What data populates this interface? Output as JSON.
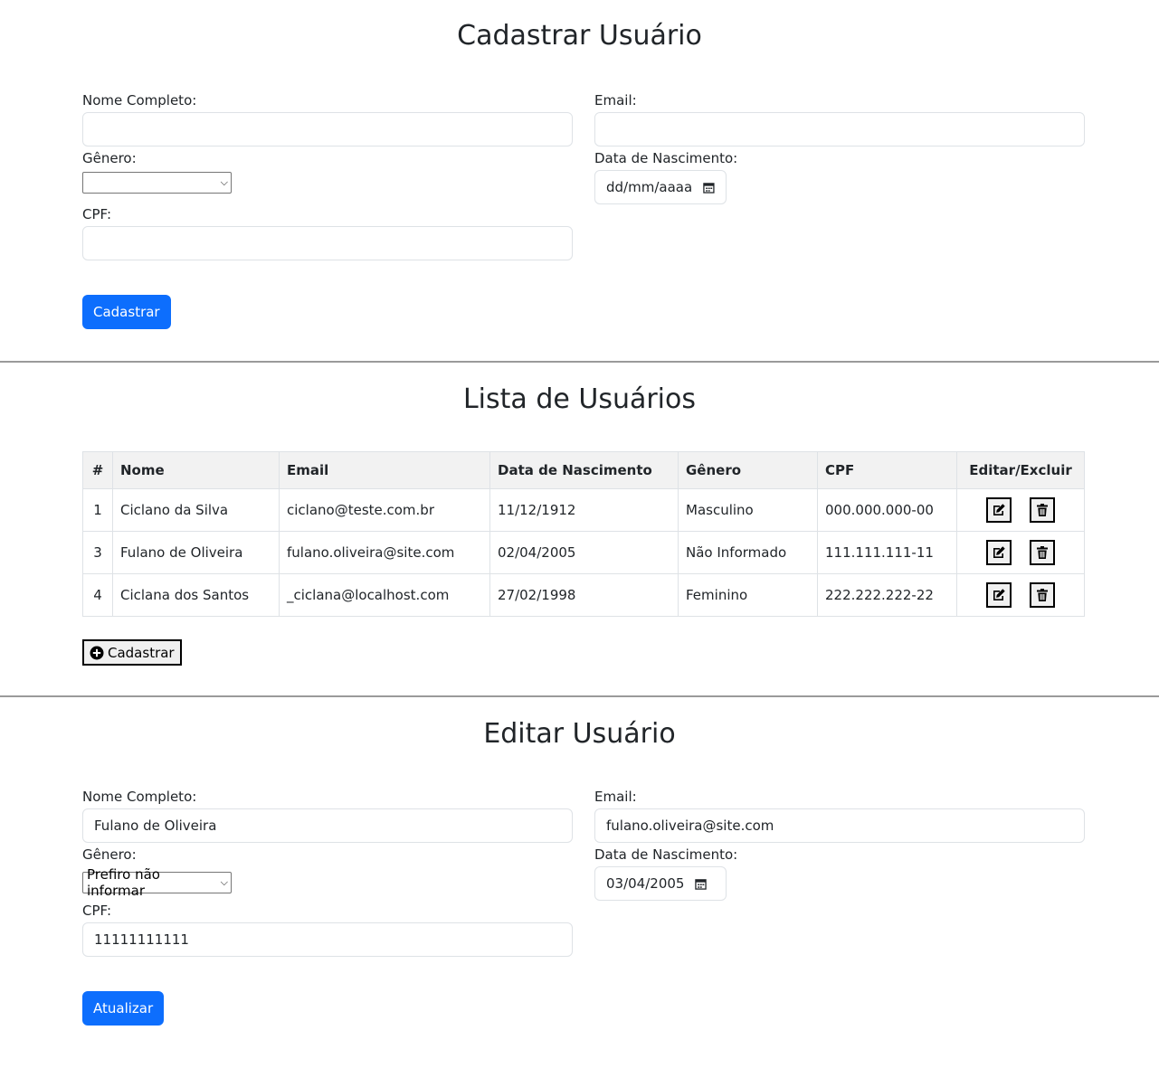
{
  "register": {
    "title": "Cadastrar Usuário",
    "name_label": "Nome Completo:",
    "name_value": "",
    "email_label": "Email:",
    "email_value": "",
    "gender_label": "Gênero:",
    "gender_value": "",
    "birth_label": "Data de Nascimento:",
    "birth_placeholder": "dd/mm/aaaa",
    "cpf_label": "CPF:",
    "cpf_value": "",
    "submit_label": "Cadastrar"
  },
  "list": {
    "title": "Lista de Usuários",
    "columns": [
      "#",
      "Nome",
      "Email",
      "Data de Nascimento",
      "Gênero",
      "CPF",
      "Editar/Excluir"
    ],
    "rows": [
      {
        "id": "1",
        "name": "Ciclano da Silva",
        "email": "ciclano@teste.com.br",
        "birth": "11/12/1912",
        "gender": "Masculino",
        "cpf": "000.000.000-00"
      },
      {
        "id": "3",
        "name": "Fulano de Oliveira",
        "email": "fulano.oliveira@site.com",
        "birth": "02/04/2005",
        "gender": "Não Informado",
        "cpf": "111.111.111-11"
      },
      {
        "id": "4",
        "name": "Ciclana dos Santos",
        "email": "_ciclana@localhost.com",
        "birth": "27/02/1998",
        "gender": "Feminino",
        "cpf": "222.222.222-22"
      }
    ],
    "add_label": "Cadastrar",
    "icons": {
      "edit": "edit-icon",
      "delete": "trash-icon",
      "add": "plus-circle-icon"
    }
  },
  "edit": {
    "title": "Editar Usuário",
    "name_label": "Nome Completo:",
    "name_value": "Fulano de Oliveira",
    "email_label": "Email:",
    "email_value": "fulano.oliveira@site.com",
    "gender_label": "Gênero:",
    "gender_value": "Prefiro não informar",
    "birth_label": "Data de Nascimento:",
    "birth_value": "03/04/2005",
    "cpf_label": "CPF:",
    "cpf_value": "11111111111",
    "submit_label": "Atualizar"
  },
  "colors": {
    "primary": "#0d6efd",
    "text": "#212529",
    "border": "#dee2e6",
    "header_bg": "#f2f2f2"
  }
}
